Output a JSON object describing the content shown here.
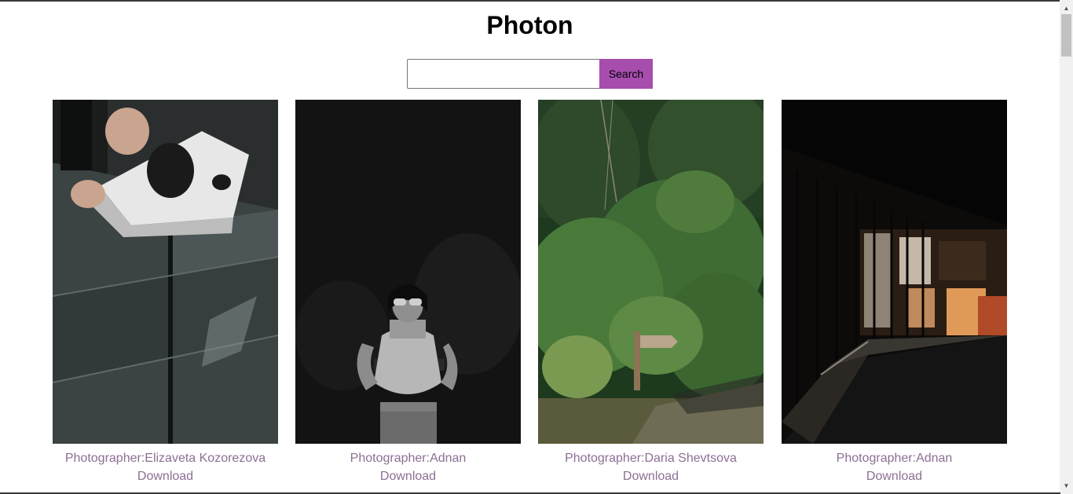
{
  "header": {
    "title": "Photon"
  },
  "search": {
    "placeholder": "",
    "value": "",
    "button_label": "Search"
  },
  "photos": [
    {
      "photographer": "Photographer:Elizaveta Kozorezova",
      "download_label": "Download"
    },
    {
      "photographer": "Photographer:Adnan",
      "download_label": "Download"
    },
    {
      "photographer": "Photographer:Daria Shevtsova",
      "download_label": "Download"
    },
    {
      "photographer": "Photographer:Adnan",
      "download_label": "Download"
    }
  ],
  "colors": {
    "accent": "#a64dae",
    "credit_text": "#8d6f94"
  }
}
